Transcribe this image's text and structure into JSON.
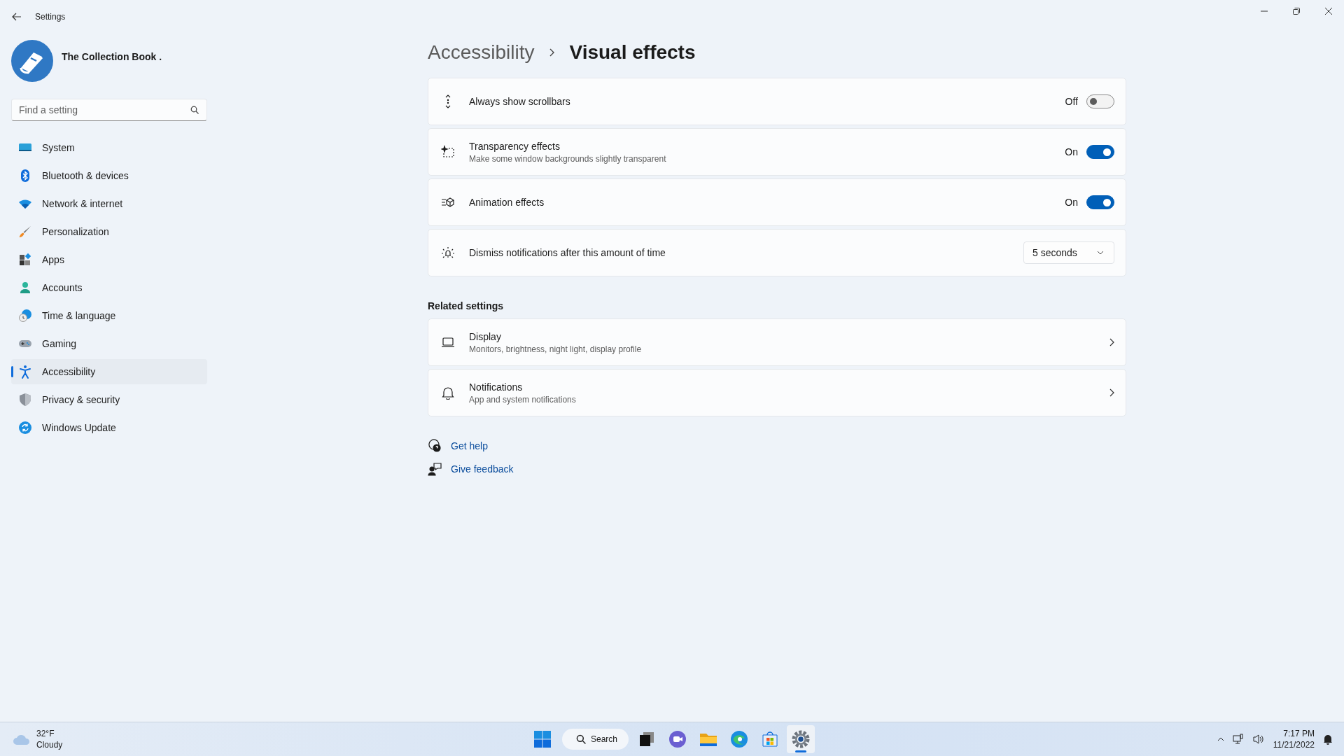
{
  "window": {
    "title": "Settings"
  },
  "profile": {
    "name": "The Collection Book ."
  },
  "search": {
    "placeholder": "Find a setting"
  },
  "nav": [
    {
      "label": "System",
      "selected": false
    },
    {
      "label": "Bluetooth & devices",
      "selected": false
    },
    {
      "label": "Network & internet",
      "selected": false
    },
    {
      "label": "Personalization",
      "selected": false
    },
    {
      "label": "Apps",
      "selected": false
    },
    {
      "label": "Accounts",
      "selected": false
    },
    {
      "label": "Time & language",
      "selected": false
    },
    {
      "label": "Gaming",
      "selected": false
    },
    {
      "label": "Accessibility",
      "selected": true
    },
    {
      "label": "Privacy & security",
      "selected": false
    },
    {
      "label": "Windows Update",
      "selected": false
    }
  ],
  "breadcrumb": {
    "parent": "Accessibility",
    "current": "Visual effects"
  },
  "settings": [
    {
      "kind": "toggle",
      "title": "Always show scrollbars",
      "on": false,
      "state_label": "Off"
    },
    {
      "kind": "toggle",
      "title": "Transparency effects",
      "description": "Make some window backgrounds slightly transparent",
      "on": true,
      "state_label": "On"
    },
    {
      "kind": "toggle",
      "title": "Animation effects",
      "on": true,
      "state_label": "On"
    },
    {
      "kind": "dropdown",
      "title": "Dismiss notifications after this amount of time",
      "value": "5 seconds"
    }
  ],
  "related": {
    "heading": "Related settings",
    "items": [
      {
        "title": "Display",
        "description": "Monitors, brightness, night light, display profile"
      },
      {
        "title": "Notifications",
        "description": "App and system notifications"
      }
    ]
  },
  "help_links": [
    "Get help",
    "Give feedback"
  ],
  "taskbar": {
    "weather": {
      "temp": "32°F",
      "condition": "Cloudy"
    },
    "search_label": "Search",
    "apps": [
      {
        "selected": false
      },
      {
        "selected": false
      },
      {
        "selected": false
      },
      {
        "selected": false
      },
      {
        "selected": false
      },
      {
        "selected": true
      }
    ],
    "time": "7:17 PM",
    "date": "11/21/2022"
  }
}
